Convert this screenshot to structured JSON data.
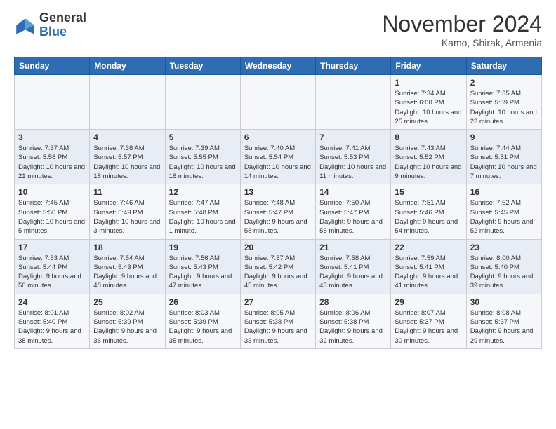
{
  "header": {
    "logo_general": "General",
    "logo_blue": "Blue",
    "month_title": "November 2024",
    "location": "Kamo, Shirak, Armenia"
  },
  "days_of_week": [
    "Sunday",
    "Monday",
    "Tuesday",
    "Wednesday",
    "Thursday",
    "Friday",
    "Saturday"
  ],
  "weeks": [
    [
      {
        "day": "",
        "info": ""
      },
      {
        "day": "",
        "info": ""
      },
      {
        "day": "",
        "info": ""
      },
      {
        "day": "",
        "info": ""
      },
      {
        "day": "",
        "info": ""
      },
      {
        "day": "1",
        "info": "Sunrise: 7:34 AM\nSunset: 6:00 PM\nDaylight: 10 hours and 25 minutes."
      },
      {
        "day": "2",
        "info": "Sunrise: 7:35 AM\nSunset: 5:59 PM\nDaylight: 10 hours and 23 minutes."
      }
    ],
    [
      {
        "day": "3",
        "info": "Sunrise: 7:37 AM\nSunset: 5:58 PM\nDaylight: 10 hours and 21 minutes."
      },
      {
        "day": "4",
        "info": "Sunrise: 7:38 AM\nSunset: 5:57 PM\nDaylight: 10 hours and 18 minutes."
      },
      {
        "day": "5",
        "info": "Sunrise: 7:39 AM\nSunset: 5:55 PM\nDaylight: 10 hours and 16 minutes."
      },
      {
        "day": "6",
        "info": "Sunrise: 7:40 AM\nSunset: 5:54 PM\nDaylight: 10 hours and 14 minutes."
      },
      {
        "day": "7",
        "info": "Sunrise: 7:41 AM\nSunset: 5:53 PM\nDaylight: 10 hours and 11 minutes."
      },
      {
        "day": "8",
        "info": "Sunrise: 7:43 AM\nSunset: 5:52 PM\nDaylight: 10 hours and 9 minutes."
      },
      {
        "day": "9",
        "info": "Sunrise: 7:44 AM\nSunset: 5:51 PM\nDaylight: 10 hours and 7 minutes."
      }
    ],
    [
      {
        "day": "10",
        "info": "Sunrise: 7:45 AM\nSunset: 5:50 PM\nDaylight: 10 hours and 5 minutes."
      },
      {
        "day": "11",
        "info": "Sunrise: 7:46 AM\nSunset: 5:49 PM\nDaylight: 10 hours and 3 minutes."
      },
      {
        "day": "12",
        "info": "Sunrise: 7:47 AM\nSunset: 5:48 PM\nDaylight: 10 hours and 1 minute."
      },
      {
        "day": "13",
        "info": "Sunrise: 7:48 AM\nSunset: 5:47 PM\nDaylight: 9 hours and 58 minutes."
      },
      {
        "day": "14",
        "info": "Sunrise: 7:50 AM\nSunset: 5:47 PM\nDaylight: 9 hours and 56 minutes."
      },
      {
        "day": "15",
        "info": "Sunrise: 7:51 AM\nSunset: 5:46 PM\nDaylight: 9 hours and 54 minutes."
      },
      {
        "day": "16",
        "info": "Sunrise: 7:52 AM\nSunset: 5:45 PM\nDaylight: 9 hours and 52 minutes."
      }
    ],
    [
      {
        "day": "17",
        "info": "Sunrise: 7:53 AM\nSunset: 5:44 PM\nDaylight: 9 hours and 50 minutes."
      },
      {
        "day": "18",
        "info": "Sunrise: 7:54 AM\nSunset: 5:43 PM\nDaylight: 9 hours and 48 minutes."
      },
      {
        "day": "19",
        "info": "Sunrise: 7:56 AM\nSunset: 5:43 PM\nDaylight: 9 hours and 47 minutes."
      },
      {
        "day": "20",
        "info": "Sunrise: 7:57 AM\nSunset: 5:42 PM\nDaylight: 9 hours and 45 minutes."
      },
      {
        "day": "21",
        "info": "Sunrise: 7:58 AM\nSunset: 5:41 PM\nDaylight: 9 hours and 43 minutes."
      },
      {
        "day": "22",
        "info": "Sunrise: 7:59 AM\nSunset: 5:41 PM\nDaylight: 9 hours and 41 minutes."
      },
      {
        "day": "23",
        "info": "Sunrise: 8:00 AM\nSunset: 5:40 PM\nDaylight: 9 hours and 39 minutes."
      }
    ],
    [
      {
        "day": "24",
        "info": "Sunrise: 8:01 AM\nSunset: 5:40 PM\nDaylight: 9 hours and 38 minutes."
      },
      {
        "day": "25",
        "info": "Sunrise: 8:02 AM\nSunset: 5:39 PM\nDaylight: 9 hours and 36 minutes."
      },
      {
        "day": "26",
        "info": "Sunrise: 8:03 AM\nSunset: 5:39 PM\nDaylight: 9 hours and 35 minutes."
      },
      {
        "day": "27",
        "info": "Sunrise: 8:05 AM\nSunset: 5:38 PM\nDaylight: 9 hours and 33 minutes."
      },
      {
        "day": "28",
        "info": "Sunrise: 8:06 AM\nSunset: 5:38 PM\nDaylight: 9 hours and 32 minutes."
      },
      {
        "day": "29",
        "info": "Sunrise: 8:07 AM\nSunset: 5:37 PM\nDaylight: 9 hours and 30 minutes."
      },
      {
        "day": "30",
        "info": "Sunrise: 8:08 AM\nSunset: 5:37 PM\nDaylight: 9 hours and 29 minutes."
      }
    ]
  ]
}
